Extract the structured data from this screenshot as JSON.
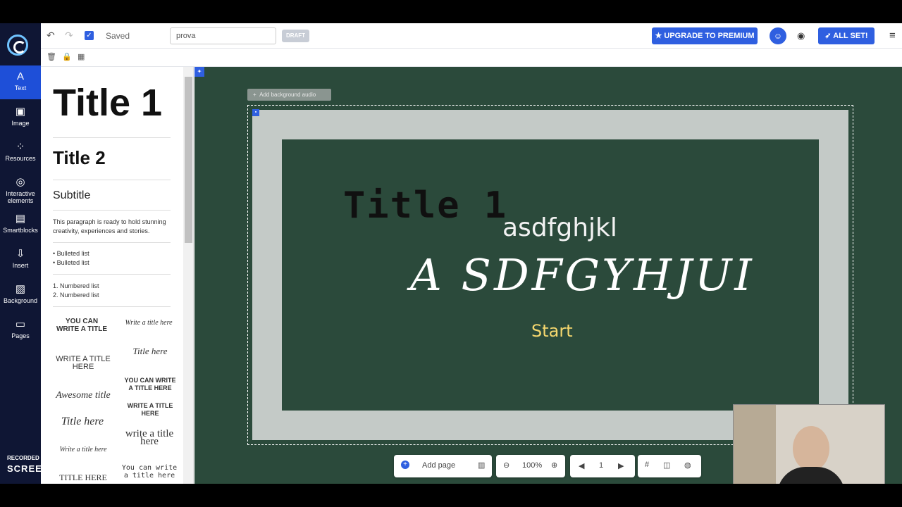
{
  "toolbar": {
    "saved": "Saved",
    "title_value": "prova",
    "draft": "DRAFT",
    "premium": "UPGRADE TO PREMIUM",
    "allset": "ALL SET!"
  },
  "rail": {
    "items": [
      {
        "label": "Text"
      },
      {
        "label": "Image"
      },
      {
        "label": "Resources"
      },
      {
        "label": "Interactive elements"
      },
      {
        "label": "Smartblocks"
      },
      {
        "label": "Insert"
      },
      {
        "label": "Background"
      },
      {
        "label": "Pages"
      }
    ]
  },
  "panel": {
    "title1": "Title 1",
    "title2": "Title 2",
    "subtitle": "Subtitle",
    "paragraph": "This paragraph is ready to hold stunning creativity, experiences and stories.",
    "bullet1": "Bulleted list",
    "bullet2": "Bulleted list",
    "num1": "1. Numbered list",
    "num2": "2. Numbered list",
    "templates": [
      "YOU CAN WRITE A TITLE",
      "Write a title here",
      "WRITE A TITLE HERE",
      "Title here",
      "Awesome title",
      "YOU CAN WRITE A TITLE HERE",
      "Title here",
      "WRITE A TITLE HERE",
      "Write a title here",
      "write a title here",
      "TITLE HERE",
      "You can write a title here"
    ]
  },
  "canvas": {
    "audio": "Add background audio",
    "title": "Title 1",
    "hand": "asdfghjkl",
    "big": "A SDFGYHJUI",
    "start": "Start"
  },
  "bottom": {
    "add_page": "Add page",
    "zoom": "100%",
    "page": "1"
  },
  "watermark": {
    "line1": "RECORDED WITH",
    "line2": "SCREENCAST-O-MATIC"
  },
  "colors": {
    "accent": "#2f5fe0",
    "rail": "#0f1634",
    "board": "#2b4a3b",
    "start": "#f5d76e"
  }
}
